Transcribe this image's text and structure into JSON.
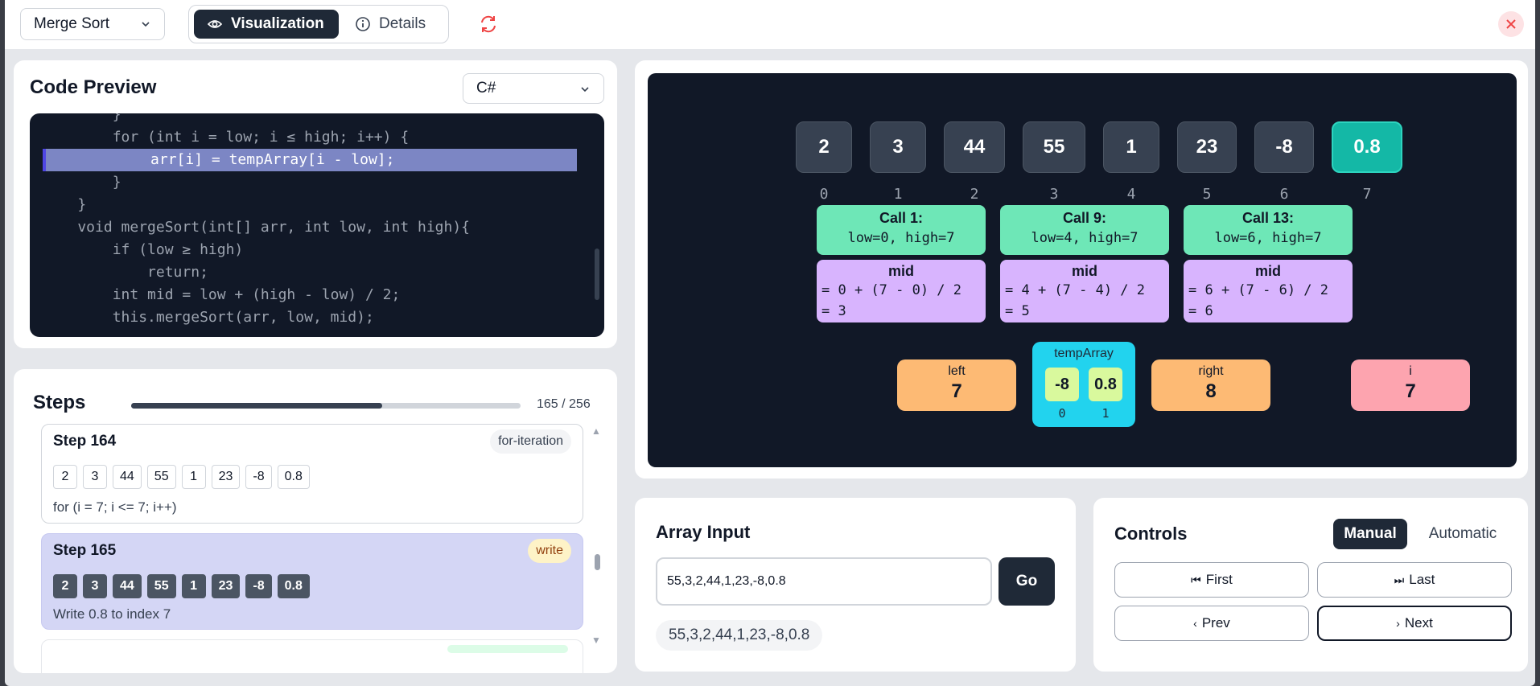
{
  "topbar": {
    "algorithm": "Merge Sort",
    "view_visualization": "Visualization",
    "view_details": "Details"
  },
  "code": {
    "title": "Code Preview",
    "language": "C#",
    "lines": [
      "        }",
      "        for (int i = low; i ≤ high; i++) {",
      "            arr[i] = tempArray[i - low];",
      "        }",
      "    }",
      "    void mergeSort(int[] arr, int low, int high){",
      "        if (low ≥ high)",
      "            return;",
      "        int mid = low + (high - low) / 2;",
      "        this.mergeSort(arr, low, mid);"
    ],
    "highlight_index": 2
  },
  "steps": {
    "title": "Steps",
    "progress_text": "165 / 256",
    "progress_fraction": 0.6445,
    "items": [
      {
        "title": "Step 164",
        "badge": "for-iteration",
        "values": [
          "2",
          "3",
          "44",
          "55",
          "1",
          "23",
          "-8",
          "0.8"
        ],
        "desc": "for (i = 7; i <= 7; i++)"
      },
      {
        "title": "Step 165",
        "badge": "write",
        "values": [
          "2",
          "3",
          "44",
          "55",
          "1",
          "23",
          "-8",
          "0.8"
        ],
        "desc": "Write 0.8 to index 7"
      }
    ]
  },
  "viz": {
    "array": [
      "2",
      "3",
      "44",
      "55",
      "1",
      "23",
      "-8",
      "0.8"
    ],
    "indices": [
      "0",
      "1",
      "2",
      "3",
      "4",
      "5",
      "6",
      "7"
    ],
    "highlight_index": 7,
    "calls": [
      {
        "title": "Call 1:",
        "sub": "low=0, high=7",
        "mid_title": "mid",
        "mid_f1": "= 0 + (7 - 0) / 2",
        "mid_f2": "= 3"
      },
      {
        "title": "Call 9:",
        "sub": "low=4, high=7",
        "mid_title": "mid",
        "mid_f1": "= 4 + (7 - 4) / 2",
        "mid_f2": "= 5"
      },
      {
        "title": "Call 13:",
        "sub": "low=6, high=7",
        "mid_title": "mid",
        "mid_f1": "= 6 + (7 - 6) / 2",
        "mid_f2": "= 6"
      }
    ],
    "left": {
      "name": "left",
      "value": "7"
    },
    "right": {
      "name": "right",
      "value": "8"
    },
    "i": {
      "name": "i",
      "value": "7"
    },
    "temp": {
      "name": "tempArray",
      "values": [
        "-8",
        "0.8"
      ],
      "indices": [
        "0",
        "1"
      ]
    }
  },
  "input": {
    "title": "Array Input",
    "value": "55,3,2,44,1,23,-8,0.8",
    "go": "Go",
    "current": "55,3,2,44,1,23,-8,0.8"
  },
  "controls": {
    "title": "Controls",
    "mode_manual": "Manual",
    "mode_automatic": "Automatic",
    "first": "First",
    "last": "Last",
    "prev": "Prev",
    "next": "Next"
  },
  "colors": {
    "accent_dark": "#1f2937",
    "highlight_cell": "#14b8a6",
    "call_green": "#6ee7b7",
    "mid_purple": "#d8b4fe",
    "var_orange": "#fdba74",
    "var_pink": "#fda4af",
    "temp_cyan": "#22d3ee",
    "close_red": "#ef4444"
  },
  "icons": [
    "chevron-down-icon",
    "eye-icon",
    "info-icon",
    "refresh-icon",
    "close-icon",
    "skip-back-icon",
    "skip-forward-icon",
    "chevron-left-icon",
    "chevron-right-icon"
  ]
}
